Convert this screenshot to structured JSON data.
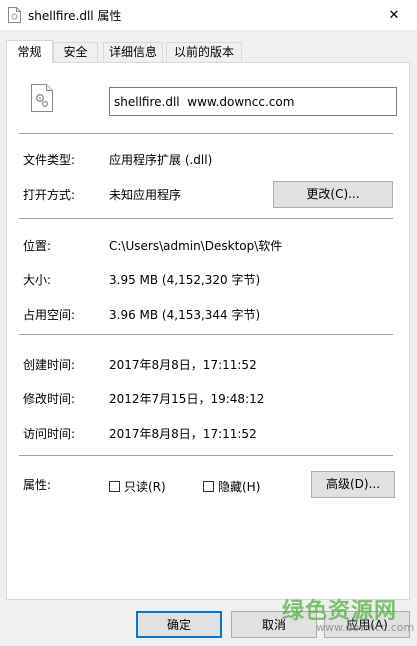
{
  "window": {
    "title": "shellfire.dll 属性",
    "close_glyph": "✕"
  },
  "tabs": [
    {
      "label": "常规",
      "active": true
    },
    {
      "label": "安全",
      "active": false
    },
    {
      "label": "详细信息",
      "active": false
    },
    {
      "label": "以前的版本",
      "active": false
    }
  ],
  "general": {
    "filename": "shellfire.dll  www.downcc.com",
    "file_type_label": "文件类型:",
    "file_type_value": "应用程序扩展 (.dll)",
    "opens_with_label": "打开方式:",
    "opens_with_value": "未知应用程序",
    "change_button": "更改(C)...",
    "location_label": "位置:",
    "location_value": "C:\\Users\\admin\\Desktop\\软件",
    "size_label": "大小:",
    "size_value": "3.95 MB (4,152,320 字节)",
    "size_on_disk_label": "占用空间:",
    "size_on_disk_value": "3.96 MB (4,153,344 字节)",
    "created_label": "创建时间:",
    "created_value": "2017年8月8日，17:11:52",
    "modified_label": "修改时间:",
    "modified_value": "2012年7月15日，19:48:12",
    "accessed_label": "访问时间:",
    "accessed_value": "2017年8月8日，17:11:52",
    "attributes_label": "属性:",
    "readonly_label": "只读(R)",
    "hidden_label": "隐藏(H)",
    "advanced_button": "高级(D)..."
  },
  "buttons": {
    "ok": "确定",
    "cancel": "取消",
    "apply": "应用(A)"
  },
  "watermark": {
    "text": "绿色资源网",
    "sub": "www.downcc.com"
  }
}
